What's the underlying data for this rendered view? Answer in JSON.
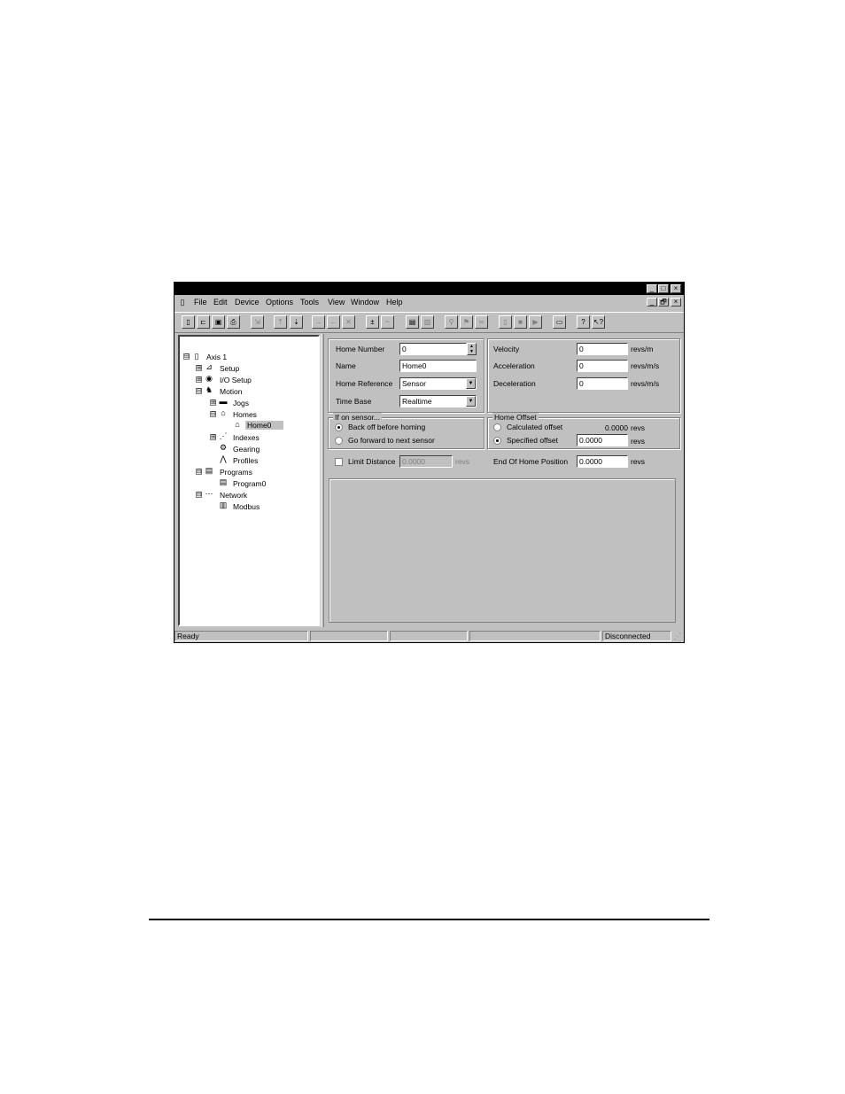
{
  "window": {
    "title": "",
    "caption_buttons": [
      "_",
      "□",
      "×"
    ],
    "mdi_buttons": [
      "_",
      "🗗",
      "×"
    ]
  },
  "menubar": {
    "items": [
      "File",
      "Edit",
      "Device",
      "Options",
      "Tools",
      "View",
      "Window",
      "Help"
    ]
  },
  "toolbar": {
    "buttons": [
      "new-icon",
      "open-icon",
      "save-icon",
      "print-icon",
      "import-icon",
      "upload-icon",
      "download-icon",
      "step-forward-icon",
      "step-back-icon",
      "delete-icon",
      "insert-icon",
      "remove-icon",
      "properties-icon",
      "list-icon",
      "zoom-icon",
      "find-icon",
      "watch-icon",
      "run-icon",
      "stop-icon",
      "pause-icon",
      "window-icon",
      "help-icon",
      "context-help-icon"
    ]
  },
  "tree": {
    "items": [
      {
        "label": "Axis 1",
        "icon": "drive-icon"
      },
      {
        "label": "Setup",
        "icon": "setup-icon"
      },
      {
        "label": "I/O Setup",
        "icon": "io-icon"
      },
      {
        "label": "Motion",
        "icon": "motion-icon"
      },
      {
        "label": "Jogs",
        "icon": "jog-icon"
      },
      {
        "label": "Homes",
        "icon": "home-icon"
      },
      {
        "label": "Home0",
        "icon": "home-icon"
      },
      {
        "label": "Indexes",
        "icon": "index-icon"
      },
      {
        "label": "Gearing",
        "icon": "gear-icon"
      },
      {
        "label": "Profiles",
        "icon": "profile-icon"
      },
      {
        "label": "Programs",
        "icon": "program-icon"
      },
      {
        "label": "Program0",
        "icon": "program-icon"
      },
      {
        "label": "Network",
        "icon": "network-icon"
      },
      {
        "label": "Modbus",
        "icon": "modbus-icon"
      }
    ],
    "expanders": [
      "⊟",
      "⊞",
      "⊞",
      "⊟",
      "⊞",
      "⊟",
      "⊞",
      "⊟",
      "⊟"
    ]
  },
  "form": {
    "home_number_label": "Home Number",
    "home_number_value": "0",
    "name_label": "Name",
    "name_value": "Home0",
    "home_reference_label": "Home Reference",
    "home_reference_value": "Sensor",
    "time_base_label": "Time Base",
    "time_base_value": "Realtime",
    "velocity_label": "Velocity",
    "velocity_value": "0",
    "velocity_unit": "revs/m",
    "acceleration_label": "Acceleration",
    "acceleration_value": "0",
    "acceleration_unit": "revs/m/s",
    "deceleration_label": "Deceleration",
    "deceleration_value": "0",
    "deceleration_unit": "revs/m/s",
    "sensor_group_title": "If on sensor...",
    "back_off_label": "Back off before homing",
    "go_forward_label": "Go forward to next sensor",
    "offset_group_title": "Home Offset",
    "calculated_offset_label": "Calculated offset",
    "calculated_offset_value": "0.0000",
    "calculated_offset_unit": "revs",
    "specified_offset_label": "Specified offset",
    "specified_offset_value": "0.0000",
    "specified_offset_unit": "revs",
    "limit_distance_label": "Limit Distance",
    "limit_distance_value": "0.0000",
    "limit_distance_unit": "revs",
    "end_position_label": "End Of Home Position",
    "end_position_value": "0.0000",
    "end_position_unit": "revs"
  },
  "status": {
    "ready": "Ready",
    "connection": "Disconnected"
  }
}
